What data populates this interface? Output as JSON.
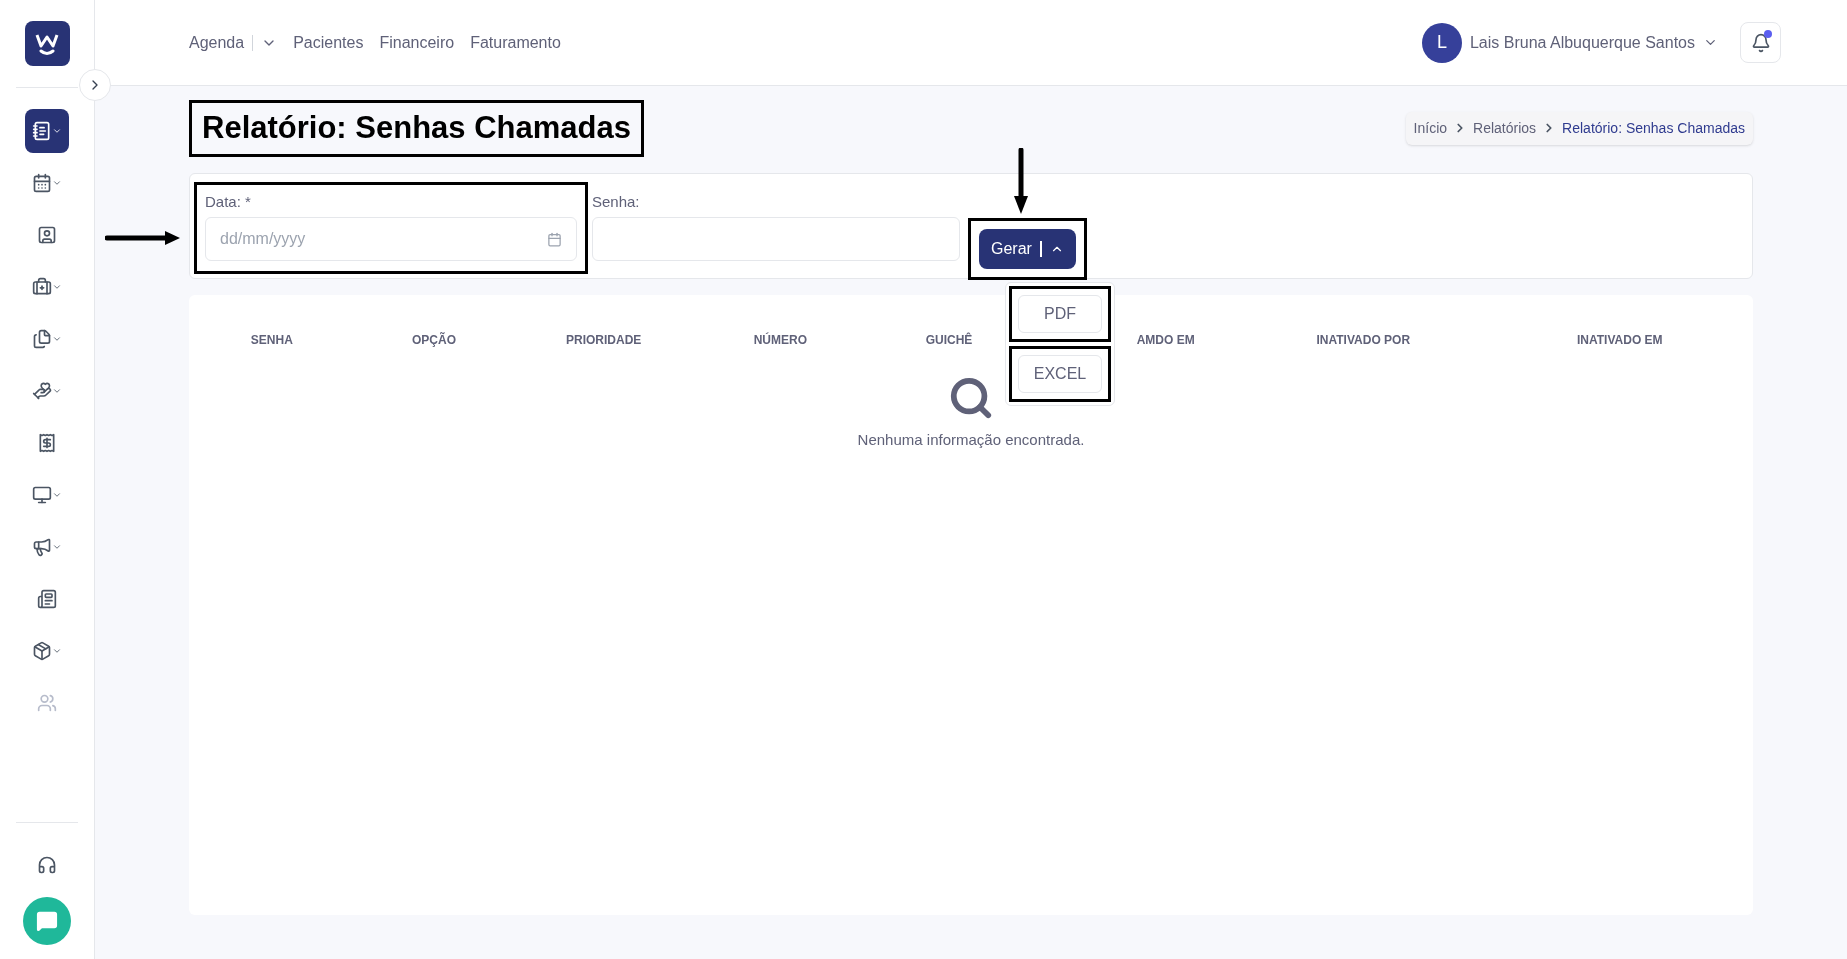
{
  "topnav": {
    "items": [
      {
        "label": "Agenda",
        "dropdown": true
      },
      {
        "label": "Pacientes",
        "dropdown": false
      },
      {
        "label": "Financeiro",
        "dropdown": false
      },
      {
        "label": "Faturamento",
        "dropdown": false
      }
    ]
  },
  "user": {
    "initial": "L",
    "name": "Lais Bruna Albuquerque Santos",
    "has_notification": true
  },
  "sidebar": {
    "items": [
      {
        "selected": true,
        "expandable": true
      },
      {
        "selected": false,
        "expandable": true
      },
      {
        "selected": false,
        "expandable": false
      },
      {
        "selected": false,
        "expandable": true
      },
      {
        "selected": false,
        "expandable": true
      },
      {
        "selected": false,
        "expandable": true
      },
      {
        "selected": false,
        "expandable": false
      },
      {
        "selected": false,
        "expandable": true
      },
      {
        "selected": false,
        "expandable": true
      },
      {
        "selected": false,
        "expandable": false
      },
      {
        "selected": false,
        "expandable": true
      },
      {
        "selected": false,
        "expandable": false,
        "disabled": true
      }
    ]
  },
  "page_title": "Relatório: Senhas Chamadas",
  "breadcrumb": [
    {
      "label": "Início",
      "selected": false
    },
    {
      "label": "Relatórios",
      "selected": false
    },
    {
      "label": "Relatório: Senhas Chamadas",
      "selected": true
    }
  ],
  "form": {
    "date_label": "Data: *",
    "date_placeholder": "dd/mm/yyyy",
    "senha_label": "Senha:",
    "generate_button": "Gerar",
    "menu_open": true,
    "menu_items": [
      "PDF",
      "EXCEL"
    ]
  },
  "table": {
    "columns": [
      "SENHA",
      "OPÇÃO",
      "PRIORIDADE",
      "NÚMERO",
      "GUICHÊ",
      "AMDO EM",
      "INATIVADO POR",
      "INATIVADO EM"
    ],
    "empty_message": "Nenhuma informação encontrada."
  }
}
